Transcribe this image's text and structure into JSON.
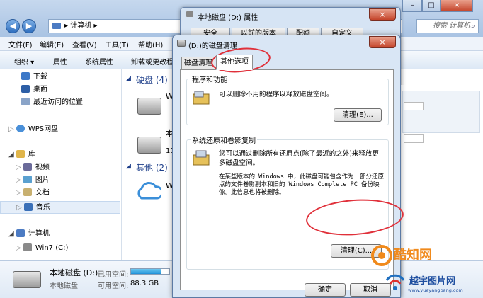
{
  "explorer": {
    "breadcrumb": [
      "计算机"
    ],
    "search_placeholder": "搜索 计算机",
    "menus": [
      "文件(F)",
      "编辑(E)",
      "查看(V)",
      "工具(T)",
      "帮助(H)"
    ],
    "toolbar": [
      "组织 ▾",
      "属性",
      "系统属性",
      "卸载或更改程序"
    ],
    "nav": [
      {
        "label": "下载",
        "icon": "download-folder-icon"
      },
      {
        "label": "桌面",
        "icon": "desktop-icon"
      },
      {
        "label": "最近访问的位置",
        "icon": "recent-places-icon"
      },
      {
        "label": "WPS网盘",
        "icon": "cloud-drive-icon"
      },
      {
        "label": "库",
        "icon": "library-icon"
      },
      {
        "label": "视频",
        "icon": "video-icon"
      },
      {
        "label": "图片",
        "icon": "pictures-icon"
      },
      {
        "label": "文档",
        "icon": "documents-icon"
      },
      {
        "label": "音乐",
        "icon": "music-icon"
      },
      {
        "label": "计算机",
        "icon": "computer-icon"
      },
      {
        "label": "Win7 (C:)",
        "icon": "drive-icon"
      },
      {
        "label": "本地磁盘 (D:)",
        "icon": "drive-icon"
      }
    ],
    "groups": {
      "hard_disks": "硬盘 (4)",
      "other": "其他 (2)"
    },
    "items": [
      "W",
      "本",
      "11",
      "W"
    ],
    "details": {
      "name": "本地磁盘 (D:)",
      "type": "本地磁盘",
      "used_label": "已用空间:",
      "free_label": "可用空间:",
      "free_value": "88.3 GB"
    }
  },
  "properties": {
    "title": "本地磁盘 (D:) 属性",
    "tabs": [
      "安全",
      "以前的版本",
      "配额",
      "自定义"
    ],
    "close": "×"
  },
  "cleanup": {
    "title": "(D:)的磁盘清理",
    "close": "×",
    "tabs": [
      "磁盘清理",
      "其他选项"
    ],
    "programs": {
      "heading": "程序和功能",
      "text": "可以删除不用的程序以释放磁盘空间。",
      "button": "清理(E)..."
    },
    "restore": {
      "heading": "系统还原和卷影复制",
      "text1": "您可以通过删除所有还原点(除了最近的之外)来释放更多磁盘空间。",
      "text2": "在某些版本的 Windows 中，此磁盘可能包含作为一部分还原点的文件卷影副本和旧的 Windows Complete PC 备份映像。此信息也将被删除。",
      "button": "清理(C)..."
    },
    "footer_buttons": [
      "确定",
      "取消"
    ]
  },
  "watermark": {
    "brand1": "酷知网",
    "brand2": "越宇图片网",
    "url": "www.yueyangbang.com"
  }
}
